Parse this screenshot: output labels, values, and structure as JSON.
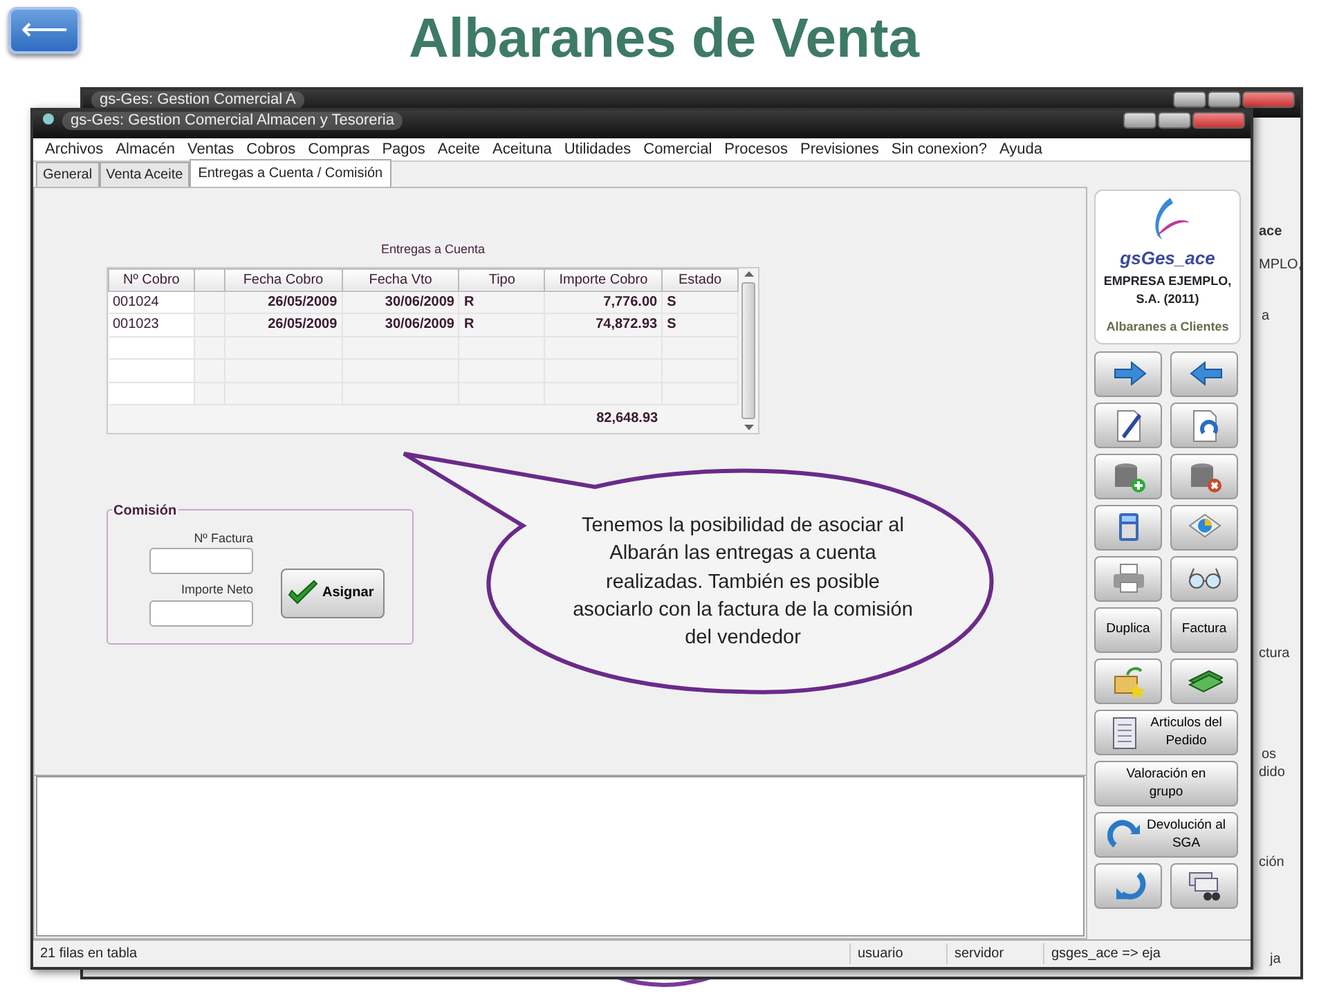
{
  "slide_title": "Albaranes de Venta",
  "back_button": {
    "symbol": "⟵"
  },
  "back_window": {
    "title": "gs-Ges: Gestion Comercial A",
    "fragments": [
      "ace",
      "MPLO,",
      "a",
      "ctura",
      "os",
      "dido",
      "ción"
    ],
    "status_fragment": "ja"
  },
  "window": {
    "title": "gs-Ges: Gestion Comercial Almacen y Tesoreria"
  },
  "menu": [
    "Archivos",
    "Almacén",
    "Ventas",
    "Cobros",
    "Compras",
    "Pagos",
    "Aceite",
    "Aceituna",
    "Utilidades",
    "Comercial",
    "Procesos",
    "Previsiones",
    "Sin conexion?",
    "Ayuda"
  ],
  "tabs": [
    {
      "label": "General",
      "selected": false
    },
    {
      "label": "Venta Aceite",
      "selected": false
    },
    {
      "label": "Entregas a Cuenta / Comisión",
      "selected": true
    }
  ],
  "table": {
    "caption": "Entregas a Cuenta",
    "columns": [
      {
        "kind": "text",
        "label": "Nº Cobro"
      },
      {
        "kind": "blank"
      },
      {
        "kind": "text",
        "label": "Fecha Cobro"
      },
      {
        "kind": "text",
        "label": "Fecha Vto"
      },
      {
        "kind": "text",
        "label": "Tipo"
      },
      {
        "kind": "text",
        "label": "Importe Cobro"
      },
      {
        "kind": "text",
        "label": "Estado"
      }
    ],
    "rows": [
      {
        "cells": [
          "001024",
          "",
          "26/05/2009",
          "30/06/2009",
          "R",
          "7,776.00",
          "S"
        ]
      },
      {
        "cells": [
          "001023",
          "",
          "26/05/2009",
          "30/06/2009",
          "R",
          "74,872.93",
          "S"
        ]
      }
    ],
    "total": "82,648.93"
  },
  "commission": {
    "legend": "Comisión",
    "fields": [
      {
        "label": "Nº Factura"
      },
      {
        "label": "Importe Neto"
      }
    ],
    "button": "Asignar"
  },
  "callout": "Tenemos la posibilidad de asociar al Albarán las entregas a cuenta  realizadas. También es posible asociarlo con la factura de la comisión del vendedor",
  "sidebar": {
    "app": "gsGes_ace",
    "company": "EMPRESA EJEMPLO, S.A. (2011)",
    "module": "Albaranes a Clientes",
    "buttons": [
      {
        "kind": "icon"
      },
      {
        "kind": "icon"
      },
      {
        "kind": "icon"
      },
      {
        "kind": "icon"
      },
      {
        "kind": "icon"
      },
      {
        "kind": "icon"
      },
      {
        "kind": "icon"
      },
      {
        "kind": "icon"
      },
      {
        "kind": "icon"
      },
      {
        "kind": "icon"
      },
      {
        "kind": "text",
        "label": "Duplica"
      },
      {
        "kind": "text",
        "label": "Factura"
      },
      {
        "kind": "icon"
      },
      {
        "kind": "icon"
      },
      {
        "kind": "wide_icon",
        "label": "Articulos del Pedido"
      },
      {
        "kind": "wide",
        "label": "Valoración en grupo"
      },
      {
        "kind": "wide_icon",
        "label": "Devolución al SGA"
      },
      {
        "kind": "icon"
      },
      {
        "kind": "icon"
      }
    ]
  },
  "status_bar": [
    "21 filas en tabla",
    "usuario",
    "servidor",
    "gsges_ace => eja"
  ]
}
